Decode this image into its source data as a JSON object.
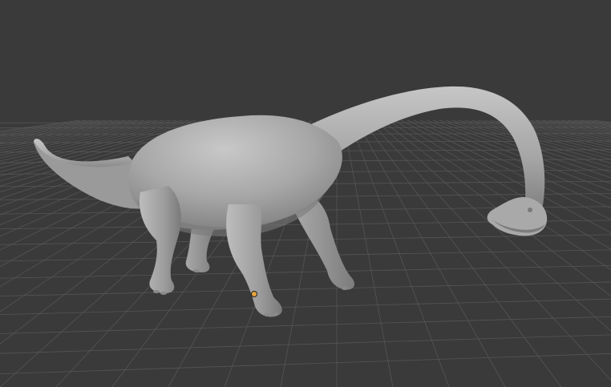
{
  "viewport": {
    "background_color": "#3a3a3a",
    "grid_line_color": "#555555",
    "model": {
      "name": "",
      "shading": "solid",
      "surface_color": "#a9a9a9",
      "shadow_color": "#6a6a6a",
      "highlight_color": "#c9c9c9"
    },
    "object_origin_color": "#e7a33a",
    "grid_visible": true
  }
}
